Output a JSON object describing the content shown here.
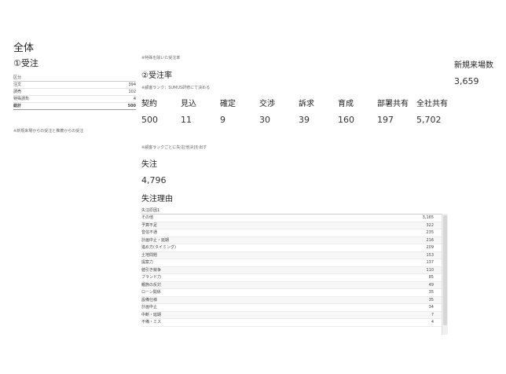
{
  "page_title": "全体",
  "section1": {
    "title": "①受注",
    "table": {
      "header": "区分",
      "rows": [
        {
          "label": "注文",
          "value": "394"
        },
        {
          "label": "請売",
          "value": "102"
        },
        {
          "label": "特殊請負",
          "value": "4"
        },
        {
          "label": "総計",
          "value": "500"
        }
      ]
    },
    "note": "※新規来場からの受注と推薦からの受注"
  },
  "section2": {
    "note_top": "※特殊を除いた受注率",
    "title": "②受注率",
    "note_rank": "※顧客ランク：SUMUS研修にて決める",
    "kpis": [
      {
        "label": "契約",
        "value": "500"
      },
      {
        "label": "見込",
        "value": "11"
      },
      {
        "label": "確定",
        "value": "9"
      },
      {
        "label": "交渉",
        "value": "30"
      },
      {
        "label": "訴求",
        "value": "39"
      },
      {
        "label": "育成",
        "value": "160"
      },
      {
        "label": "部署共有",
        "value": "197"
      },
      {
        "label": "全社共有",
        "value": "5,702"
      }
    ],
    "note_lost": "※顧客ランクごとに失注[他決]を出す"
  },
  "new_visits": {
    "label": "新規来場数",
    "value": "3,659"
  },
  "lost_orders": {
    "label": "失注",
    "value": "4,796"
  },
  "lost_reasons": {
    "title": "失注理由",
    "header": "失注原因1",
    "rows": [
      {
        "label": "その他",
        "value": "3,165"
      },
      {
        "label": "予算不足",
        "value": "322"
      },
      {
        "label": "音信不通",
        "value": "235"
      },
      {
        "label": "計画中止・延期",
        "value": "216"
      },
      {
        "label": "進め方(タイミング)",
        "value": "209"
      },
      {
        "label": "土地問題",
        "value": "153"
      },
      {
        "label": "提案力",
        "value": "137"
      },
      {
        "label": "値引き競争",
        "value": "110"
      },
      {
        "label": "ブランド力",
        "value": "85"
      },
      {
        "label": "親族の反対",
        "value": "49"
      },
      {
        "label": "ローン関係",
        "value": "35"
      },
      {
        "label": "設備仕様",
        "value": "35"
      },
      {
        "label": "計画中止",
        "value": "34"
      },
      {
        "label": "中断・延期",
        "value": "7"
      },
      {
        "label": "不備・ミス",
        "value": "4"
      }
    ]
  }
}
